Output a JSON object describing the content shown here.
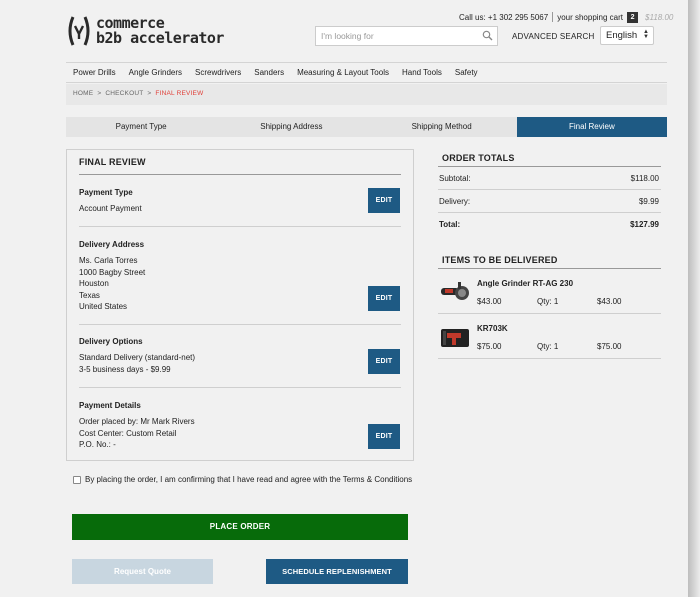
{
  "header": {
    "logo_line1": "commerce",
    "logo_line2": "b2b accelerator",
    "call_us": "Call us: +1 302 295 5067",
    "cart_label": "your shopping cart",
    "cart_count": "2",
    "cart_price": "$118.00",
    "search_placeholder": "I'm looking for",
    "advanced_search": "ADVANCED SEARCH",
    "language": "English"
  },
  "nav": [
    "Power Drills",
    "Angle Grinders",
    "Screwdrivers",
    "Sanders",
    "Measuring & Layout Tools",
    "Hand Tools",
    "Safety"
  ],
  "breadcrumb": {
    "home": "HOME",
    "checkout": "CHECKOUT",
    "current": "FINAL REVIEW",
    "separator": ">"
  },
  "steps": [
    "Payment Type",
    "Shipping Address",
    "Shipping Method",
    "Final Review"
  ],
  "review": {
    "title": "FINAL REVIEW",
    "edit_label": "EDIT",
    "payment_type": {
      "title": "Payment Type",
      "lines": [
        "Account Payment"
      ]
    },
    "delivery_address": {
      "title": "Delivery Address",
      "lines": [
        "Ms. Carla Torres",
        "1000 Bagby Street",
        "Houston",
        "Texas",
        "United States"
      ]
    },
    "delivery_options": {
      "title": "Delivery Options",
      "lines": [
        "Standard Delivery (standard-net)",
        "3-5 business days - $9.99"
      ]
    },
    "payment_details": {
      "title": "Payment Details",
      "lines": [
        "Order placed by: Mr Mark Rivers",
        "Cost Center: Custom Retail",
        "P.O. No.: -"
      ]
    }
  },
  "terms": "By placing the order, I am confirming that I have read and agree with the Terms & Conditions",
  "buttons": {
    "place_order": "PLACE ORDER",
    "request_quote": "Request Quote",
    "schedule": "SCHEDULE REPLENISHMENT"
  },
  "totals": {
    "title": "ORDER TOTALS",
    "subtotal_label": "Subtotal:",
    "subtotal": "$118.00",
    "delivery_label": "Delivery:",
    "delivery": "$9.99",
    "total_label": "Total:",
    "total": "$127.99"
  },
  "items": {
    "title": "ITEMS TO BE DELIVERED",
    "list": [
      {
        "name": "Angle Grinder RT-AG 230",
        "price": "$43.00",
        "qty": "Qty: 1",
        "total": "$43.00"
      },
      {
        "name": "KR703K",
        "price": "$75.00",
        "qty": "Qty: 1",
        "total": "$75.00"
      }
    ]
  },
  "colors": {
    "primary_blue": "#1e5a84",
    "place_green": "#076b0a",
    "breadcrumb_active": "#e0413a"
  }
}
